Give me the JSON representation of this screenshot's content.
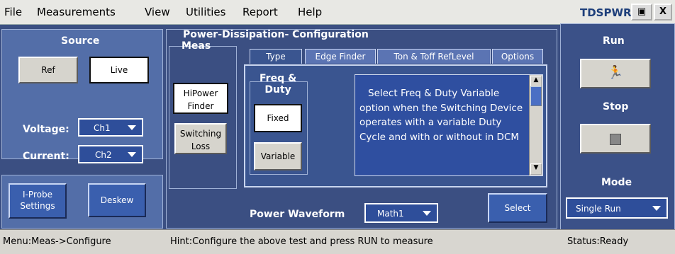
{
  "menu": {
    "file": "File",
    "measurements": "Measurements",
    "view": "View",
    "utilities": "Utilities",
    "report": "Report",
    "help": "Help"
  },
  "app_name": "TDSPWR3",
  "window_buttons": {
    "minimize": "▣",
    "close": "X"
  },
  "source": {
    "title": "Source",
    "ref_label": "Ref",
    "live_label": "Live",
    "voltage_label": "Voltage:",
    "voltage_value": "Ch1",
    "current_label": "Current:",
    "current_value": "Ch2",
    "iprobe_label_line1": "I-Probe",
    "iprobe_label_line2": "Settings",
    "deskew_label": "Deskew"
  },
  "config": {
    "title": "Power-Dissipation- Configuration",
    "meas_label": "Meas",
    "hipower_line1": "HiPower",
    "hipower_line2": "Finder",
    "switching_line1": "Switching",
    "switching_line2": "Loss",
    "tabs": [
      "Type",
      "Edge Finder",
      "Ton & Toff RefLevel",
      "Options"
    ],
    "freq_duty_line1": "Freq &",
    "freq_duty_line2": "Duty",
    "fixed_label": "Fixed",
    "variable_label": "Variable",
    "info_text": "Select Freq & Duty Variable option when the Switching Device operates with a variable Duty Cycle and with or without in DCM",
    "power_waveform_label": "Power Waveform",
    "power_waveform_value": "Math1",
    "select_label": "Select"
  },
  "right_panel": {
    "run_label": "Run",
    "stop_label": "Stop",
    "mode_label": "Mode",
    "mode_value": "Single Run"
  },
  "status": {
    "menu": "Menu:Meas->Configure",
    "hint": "Hint:Configure the above test and press RUN to measure",
    "status": "Status:Ready"
  }
}
